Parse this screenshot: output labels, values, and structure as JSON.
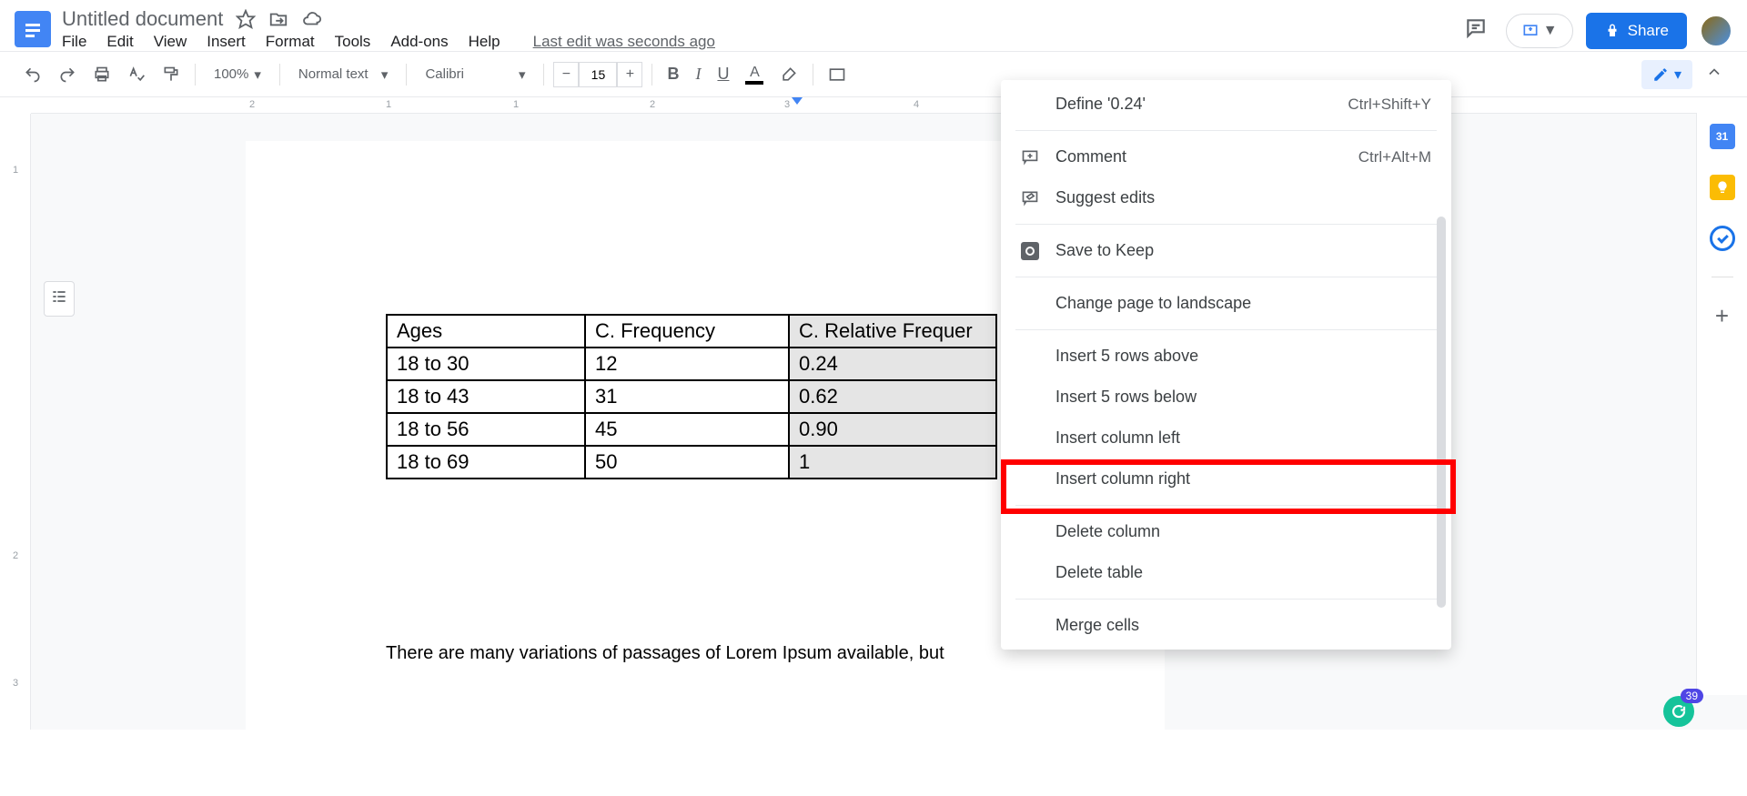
{
  "header": {
    "title": "Untitled document",
    "menus": [
      "File",
      "Edit",
      "View",
      "Insert",
      "Format",
      "Tools",
      "Add-ons",
      "Help"
    ],
    "last_edit": "Last edit was seconds ago",
    "share_label": "Share"
  },
  "toolbar": {
    "zoom": "100%",
    "style": "Normal text",
    "font": "Calibri",
    "size": "15"
  },
  "ruler": {
    "h": [
      "2",
      "1",
      "1",
      "2",
      "3",
      "4"
    ],
    "v": [
      "1",
      "2",
      "3"
    ]
  },
  "table": {
    "headers": [
      "Ages",
      "C. Frequency",
      "C. Relative Frequer"
    ],
    "rows": [
      [
        "18 to 30",
        "12",
        "0.24"
      ],
      [
        "18 to 43",
        "31",
        "0.62"
      ],
      [
        "18 to 56",
        "45",
        "0.90"
      ],
      [
        "18 to 69",
        "50",
        "1"
      ]
    ]
  },
  "body_text": "There are many variations of passages of Lorem Ipsum available, but",
  "ctx": {
    "define": "Define '0.24'",
    "define_short": "Ctrl+Shift+Y",
    "comment": "Comment",
    "comment_short": "Ctrl+Alt+M",
    "suggest": "Suggest edits",
    "keep": "Save to Keep",
    "landscape": "Change page to landscape",
    "rows_above": "Insert 5 rows above",
    "rows_below": "Insert 5 rows below",
    "col_left": "Insert column left",
    "col_right": "Insert column right",
    "del_col": "Delete column",
    "del_table": "Delete table",
    "merge": "Merge cells"
  },
  "side": {
    "calendar_day": "31"
  },
  "grammarly": {
    "count": "39"
  }
}
